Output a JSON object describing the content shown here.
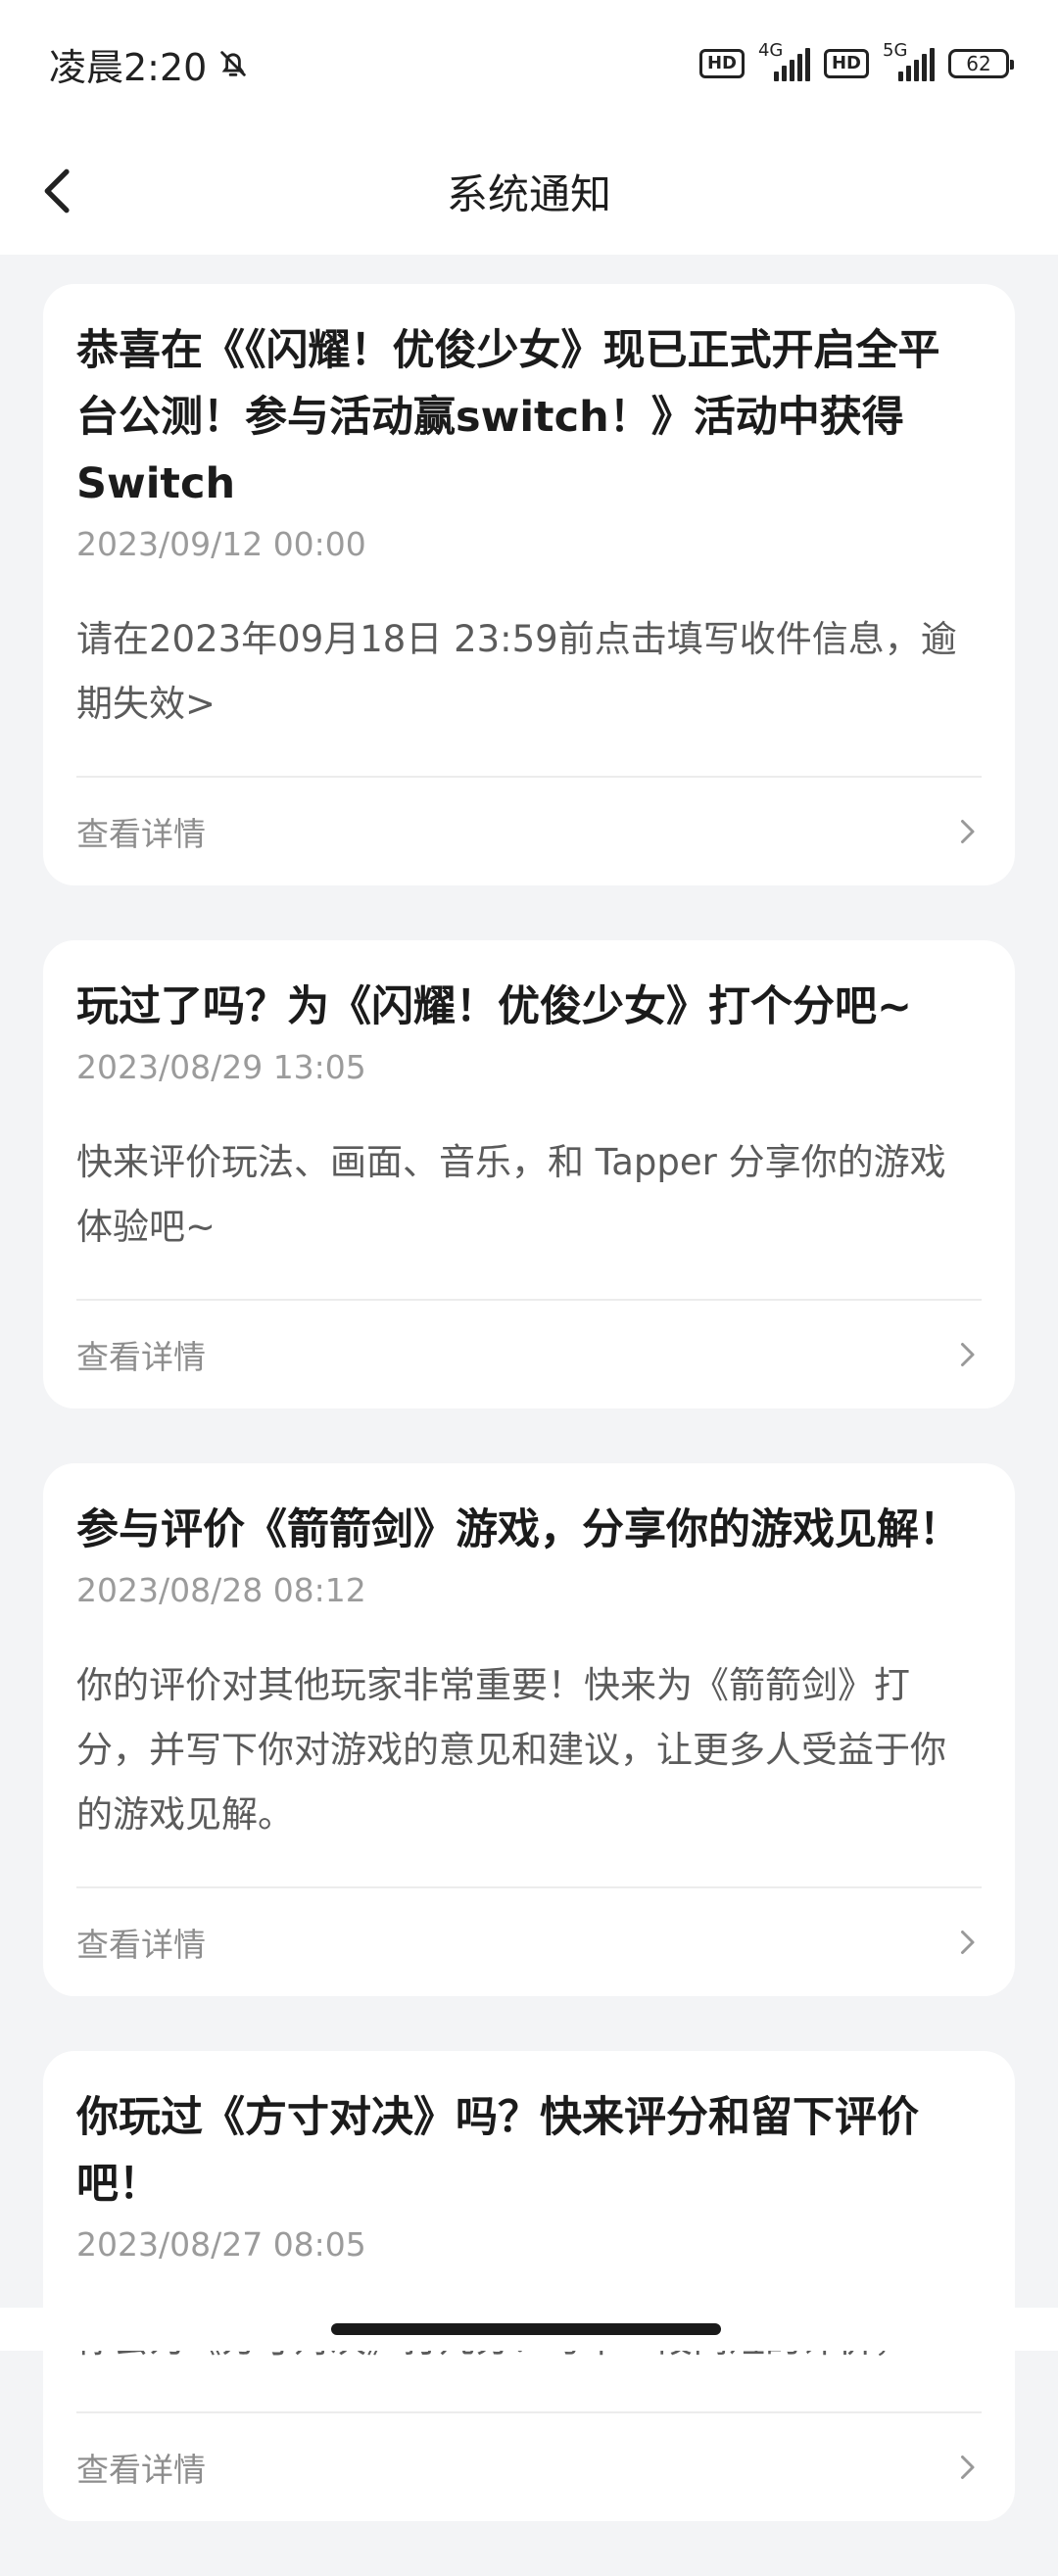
{
  "status": {
    "time": "凌晨2:20",
    "bell_icon": "bell-off-icon",
    "hd1": "HD",
    "net1": "4G",
    "hd2": "HD",
    "net2": "5G",
    "battery": "62"
  },
  "header": {
    "title": "系统通知",
    "back_icon": "chevron-left-icon"
  },
  "notifications": [
    {
      "title": "恭喜在《《闪耀！优俊少女》现已正式开启全平台公测！参与活动赢switch！》活动中获得Switch",
      "time": "2023/09/12 00:00",
      "body": "请在2023年09月18日 23:59前点击填写收件信息，逾期失效>",
      "detail": "查看详情"
    },
    {
      "title": "玩过了吗？为《闪耀！优俊少女》打个分吧~",
      "time": "2023/08/29 13:05",
      "body": "快来评价玩法、画面、音乐，和 Tapper 分享你的游戏体验吧~",
      "detail": "查看详情"
    },
    {
      "title": "参与评价《箭箭剑》游戏，分享你的游戏见解！",
      "time": "2023/08/28 08:12",
      "body": "你的评价对其他玩家非常重要！快来为《箭箭剑》打分，并写下你对游戏的意见和建议，让更多人受益于你的游戏见解。",
      "detail": "查看详情"
    },
    {
      "title": "你玩过《方寸对决》吗？快来评分和留下评价吧！",
      "time": "2023/08/27 08:05",
      "body": "你会为《方寸对决》打几分？写下一段简短的评价，",
      "detail": "查看详情"
    }
  ]
}
